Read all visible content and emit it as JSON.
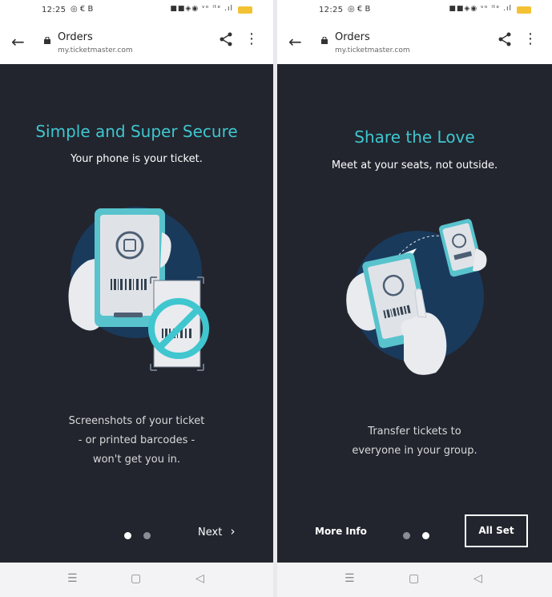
{
  "status_bar": {
    "time": "12:25",
    "notification_icons": "◎ € B",
    "system_icons": "■■◈◉ ᵛᵒ ˡᵗᵉ .ıl"
  },
  "browser": {
    "page_title": "Orders",
    "domain": "my.ticketmaster.com"
  },
  "screens": [
    {
      "heading": "Simple and Super Secure",
      "subheading": "Your phone is your ticket.",
      "body_lines": [
        "Screenshots of your ticket",
        "- or printed barcodes -",
        "won't get you in."
      ],
      "next_label": "Next",
      "page_index": 1,
      "page_count": 2
    },
    {
      "heading": "Share the Love",
      "subheading": "Meet at your seats, not outside.",
      "body_lines": [
        "Transfer tickets to",
        "everyone in your group."
      ],
      "more_info_label": "More Info",
      "all_set_label": "All Set",
      "page_index": 2,
      "page_count": 2
    }
  ],
  "colors": {
    "accent": "#3fc6cf",
    "background": "#22252e",
    "circle": "#1a3a5c",
    "battery": "#f3c234"
  }
}
